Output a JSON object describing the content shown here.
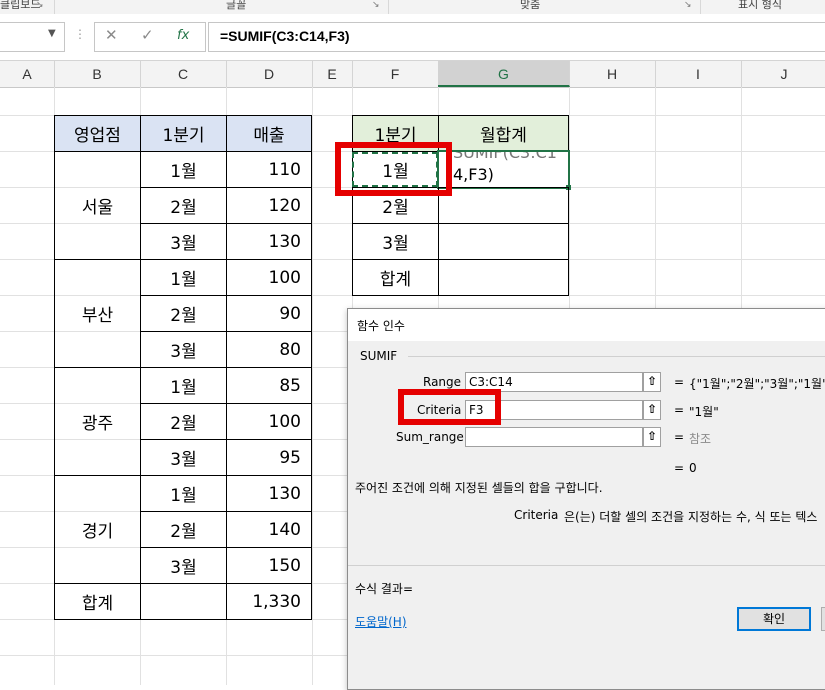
{
  "ribbon": {
    "groups": [
      {
        "label": "클립보드"
      },
      {
        "label": "글꼴"
      },
      {
        "label": "맞춤"
      },
      {
        "label": "표시 형식"
      }
    ]
  },
  "formula_bar": {
    "name_box_value": "",
    "cancel_icon": "✕",
    "enter_icon": "✓",
    "fx_icon": "fx",
    "formula": "=SUMIF(C3:C14,F3)"
  },
  "columns": [
    "A",
    "B",
    "C",
    "D",
    "E",
    "F",
    "G",
    "H",
    "I",
    "J"
  ],
  "selected_column": "G",
  "table1": {
    "headers": [
      "영업점",
      "1분기",
      "매출"
    ],
    "regions": [
      "서울",
      "부산",
      "광주",
      "경기"
    ],
    "months": [
      "1월",
      "2월",
      "3월",
      "1월",
      "2월",
      "3월",
      "1월",
      "2월",
      "3월",
      "1월",
      "2월",
      "3월"
    ],
    "sales": [
      "110",
      "120",
      "130",
      "100",
      "90",
      "80",
      "85",
      "100",
      "95",
      "130",
      "140",
      "150"
    ],
    "total_label": "합계",
    "total_value": "1,330"
  },
  "table2": {
    "headers": [
      "1분기",
      "월합계"
    ],
    "rows": [
      "1월",
      "2월",
      "3월",
      "합계"
    ],
    "edit_text_line1": "SUMIF(C3:C1",
    "edit_text_line2": "4,F3)"
  },
  "dialog": {
    "title": "함수 인수",
    "function_name": "SUMIF",
    "args": [
      {
        "label": "Range",
        "value": "C3:C14",
        "result": "{\"1월\";\"2월\";\"3월\";\"1월\";\""
      },
      {
        "label": "Criteria",
        "value": "F3",
        "result": "\"1월\""
      },
      {
        "label": "Sum_range",
        "value": "",
        "result": "참조"
      }
    ],
    "equals": "=",
    "total_result": "0",
    "description": "주어진 조건에 의해 지정된 셀들의 합을 구합니다.",
    "arg_help_name": "Criteria",
    "arg_help_text": "은(는) 더할 셀의 조건을 지정하는 수, 식 또는 텍스",
    "formula_result_label": "수식 결과=",
    "help_link": "도움말(H)",
    "ok_label": "확인"
  }
}
